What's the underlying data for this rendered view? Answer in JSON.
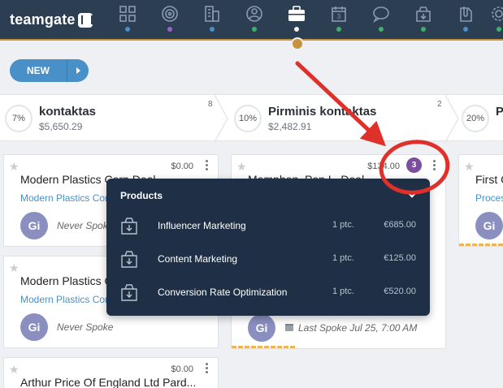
{
  "app": {
    "logo_text": "teamgate",
    "nav_icons": [
      "dashboard-icon",
      "target-icon",
      "companies-icon",
      "people-icon",
      "deals-icon",
      "calendar-icon",
      "chat-icon",
      "products-icon",
      "documents-icon",
      "settings-icon"
    ],
    "nav_dot_colors": [
      "#4a90c8",
      "#a05fd0",
      "#4a90c8",
      "#3fb06a",
      "#f2f2f2",
      "#3fb06a",
      "#3fb06a",
      "#3fb06a",
      "#4a90c8",
      "#3fb06a"
    ],
    "accent_color": "#c6923c"
  },
  "toolbar": {
    "new_label": "NEW"
  },
  "stages": [
    {
      "pct": "7%",
      "name": "kontaktas",
      "amount": "$5,650.29",
      "count": "8"
    },
    {
      "pct": "10%",
      "name": "Pirminis kontaktas",
      "amount": "$2,482.91",
      "count": "2"
    },
    {
      "pct": "20%",
      "name": "P",
      "amount": "",
      "count": ""
    }
  ],
  "columns": {
    "col1": [
      {
        "amount": "$0.00",
        "title": "Modern Plastics Corp Deal",
        "company": "Modern Plastics Corp",
        "avatar": "Gi",
        "spoke": "Never Spoke"
      },
      {
        "amount": "",
        "title": "Modern Plastics Corp",
        "company": "Modern Plastics Corp",
        "avatar": "Gi",
        "spoke": "Never Spoke"
      },
      {
        "amount": "$0.00",
        "title": "Arthur Price Of England Ltd Pard...",
        "company": "",
        "avatar": "",
        "spoke": ""
      }
    ],
    "col2": [
      {
        "amount": "$134.00",
        "title": "Memphon, Pen L. Deal",
        "badge": "3",
        "avatar": "Gi",
        "spoke": "Last Spoke Jul 25, 7:00 AM"
      }
    ],
    "col3": [
      {
        "title": "First C",
        "company": "Proces",
        "avatar": "Gi"
      }
    ]
  },
  "products_popup": {
    "title": "Products",
    "items": [
      {
        "name": "Influencer Marketing",
        "qty": "1 ptc.",
        "price": "€685.00"
      },
      {
        "name": "Content Marketing",
        "qty": "1 ptc.",
        "price": "€125.00"
      },
      {
        "name": "Conversion Rate Optimization",
        "qty": "1 ptc.",
        "price": "€520.00"
      }
    ]
  },
  "annotation_color": "#e0302a"
}
